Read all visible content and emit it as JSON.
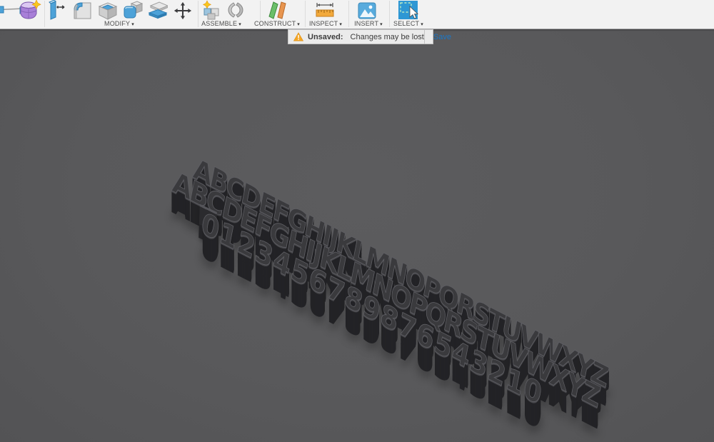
{
  "toolbar": {
    "dropdown_arrow": "▾",
    "groups": [
      {
        "label": "MODIFY",
        "icons": [
          "press-pull",
          "fillet",
          "shell",
          "combine",
          "offset-face",
          "move-copy"
        ]
      },
      {
        "label": "ASSEMBLE",
        "icons": [
          "new-component",
          "joint"
        ]
      },
      {
        "label": "CONSTRUCT",
        "icons": [
          "construction-plane"
        ]
      },
      {
        "label": "INSPECT",
        "icons": [
          "measure"
        ]
      },
      {
        "label": "INSERT",
        "icons": [
          "insert-image"
        ]
      },
      {
        "label": "SELECT",
        "icons": [
          "select-window"
        ]
      }
    ],
    "other_icons": [
      "sketch-constraint (clipped at left edge)",
      "create-form"
    ]
  },
  "notification": {
    "title": "Unsaved:",
    "message": "Changes may be lost",
    "action": "Save",
    "colors": {
      "warning": "#f5a623",
      "action_link": "#1b78c8",
      "bar_bg": "#ebebeb"
    }
  },
  "viewport": {
    "background": "#59595b",
    "model_rows": [
      {
        "text": "ABCDEFGHIJKLMNOPQRSTUVWXYZ"
      },
      {
        "text": "ABCDEFGHIJKLMNOPQRSTUVWXYZ"
      },
      {
        "text": "0123456789876543210"
      }
    ],
    "model_color": "#3a3a3d",
    "accent_blue": "#4da2d8"
  }
}
